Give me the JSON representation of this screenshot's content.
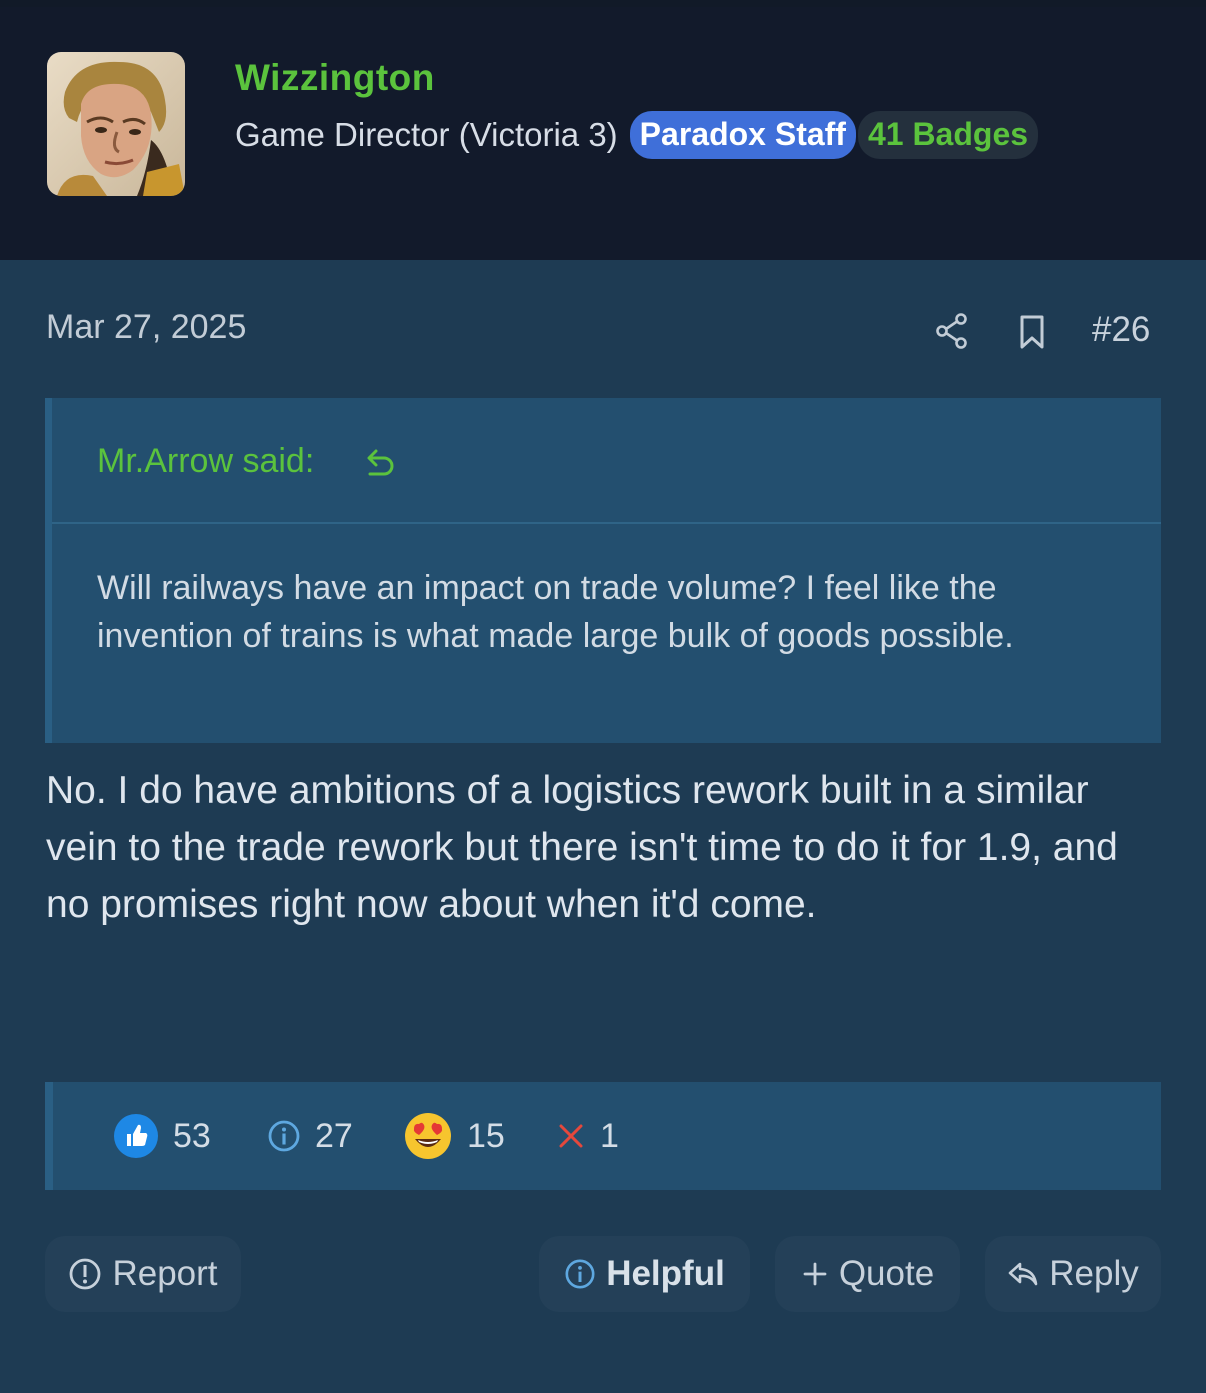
{
  "author": {
    "username": "Wizzington",
    "user_title": "Game Director (Victoria 3)",
    "staff_badge": "Paradox Staff",
    "badges_count": "41 Badges"
  },
  "post": {
    "date": "Mar 27, 2025",
    "number": "#26",
    "quote": {
      "author_label": "Mr.Arrow said:",
      "text": "Will railways have an impact on trade volume? I feel like the invention of trains is what made large bulk of goods possible."
    },
    "message": "No. I do have ambitions of a logistics rework built in a similar vein to the trade rework but there isn't time to do it for 1.9, and no promises right now about when it'd come."
  },
  "reactions": [
    {
      "icon": "thumbs-up-icon",
      "count": "53"
    },
    {
      "icon": "info-icon",
      "count": "27"
    },
    {
      "icon": "heart-eyes-icon",
      "count": "15"
    },
    {
      "icon": "x-icon",
      "count": "1"
    }
  ],
  "actions": {
    "report": "Report",
    "helpful": "Helpful",
    "quote": "Quote",
    "reply": "Reply"
  },
  "colors": {
    "accent_green": "#5bc33d",
    "staff_blue": "#3f6fd9",
    "background": "#1e3b53",
    "header_bg": "#121a2b"
  }
}
